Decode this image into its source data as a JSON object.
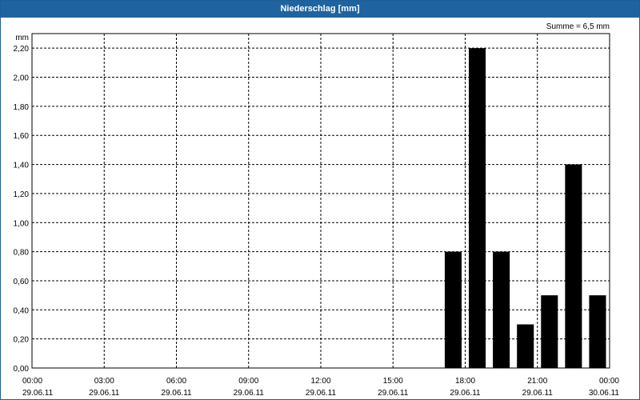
{
  "window": {
    "title": "Niederschlag [mm]"
  },
  "colors": {
    "title_bar": "#1f64a0",
    "bars": "#000000",
    "grid": "#000000"
  },
  "chart_data": {
    "type": "bar",
    "title": "Niederschlag [mm]",
    "ylabel": "mm",
    "annotation": "Summe = 6,5 mm",
    "ylim": [
      0,
      2.3
    ],
    "yticks": [
      "0,00",
      "0,20",
      "0,40",
      "0,60",
      "0,80",
      "1,00",
      "1,20",
      "1,40",
      "1,60",
      "1,80",
      "2,00",
      "2,20"
    ],
    "xlim": [
      "2011-06-29 00:00",
      "2011-06-30 00:00"
    ],
    "xticks": [
      {
        "time": "00:00",
        "date": "29.06.11"
      },
      {
        "time": "03:00",
        "date": "29.06.11"
      },
      {
        "time": "06:00",
        "date": "29.06.11"
      },
      {
        "time": "09:00",
        "date": "29.06.11"
      },
      {
        "time": "12:00",
        "date": "29.06.11"
      },
      {
        "time": "15:00",
        "date": "29.06.11"
      },
      {
        "time": "18:00",
        "date": "29.06.11"
      },
      {
        "time": "21:00",
        "date": "29.06.11"
      },
      {
        "time": "00:00",
        "date": "30.06.11"
      }
    ],
    "grid": true,
    "bars": [
      {
        "start": "2011-06-29 17:00",
        "end": "2011-06-29 18:00",
        "value": 0.8
      },
      {
        "start": "2011-06-29 18:00",
        "end": "2011-06-29 19:00",
        "value": 2.2
      },
      {
        "start": "2011-06-29 19:00",
        "end": "2011-06-29 20:00",
        "value": 0.8
      },
      {
        "start": "2011-06-29 20:00",
        "end": "2011-06-29 21:00",
        "value": 0.3
      },
      {
        "start": "2011-06-29 21:00",
        "end": "2011-06-29 22:00",
        "value": 0.5
      },
      {
        "start": "2011-06-29 22:00",
        "end": "2011-06-29 23:00",
        "value": 1.4
      },
      {
        "start": "2011-06-29 23:00",
        "end": "2011-06-30 00:00",
        "value": 0.5
      }
    ]
  }
}
